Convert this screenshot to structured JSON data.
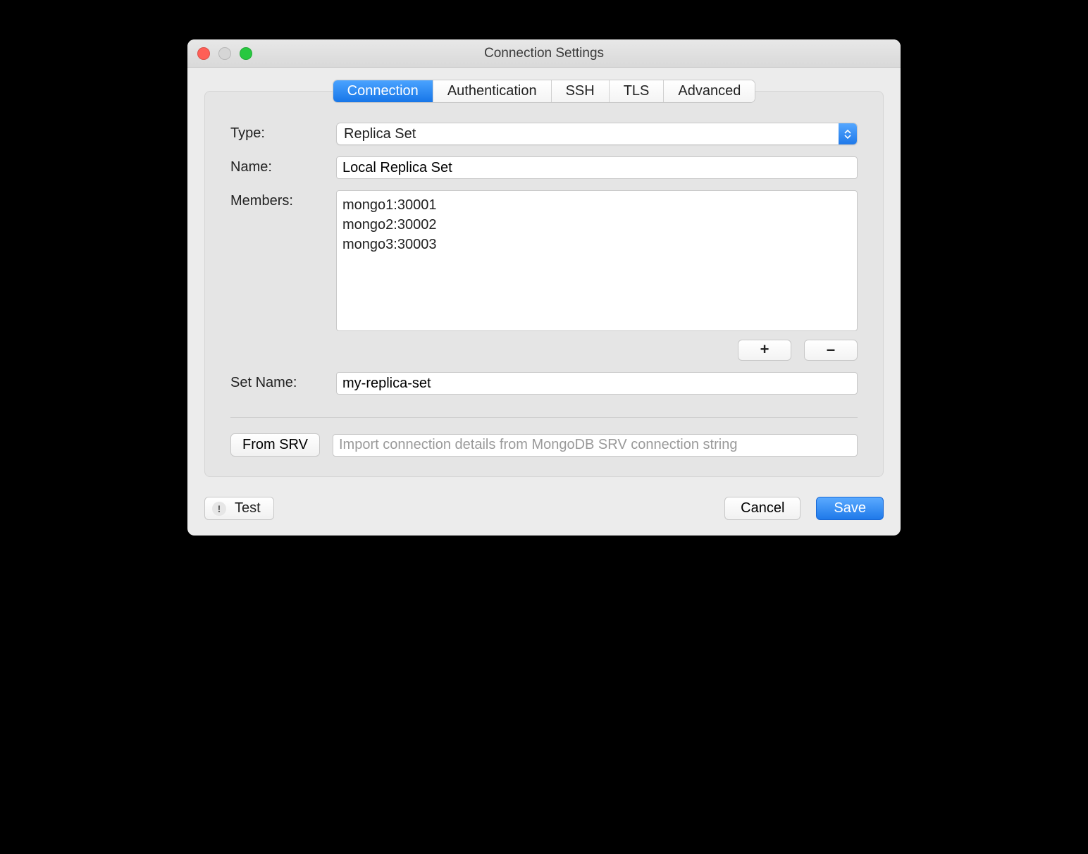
{
  "window": {
    "title": "Connection Settings"
  },
  "tabs": {
    "connection": "Connection",
    "authentication": "Authentication",
    "ssh": "SSH",
    "tls": "TLS",
    "advanced": "Advanced"
  },
  "form": {
    "type_label": "Type:",
    "type_value": "Replica Set",
    "name_label": "Name:",
    "name_value": "Local Replica Set",
    "members_label": "Members:",
    "members": [
      "mongo1:30001",
      "mongo2:30002",
      "mongo3:30003"
    ],
    "add_label": "+",
    "remove_label": "–",
    "setname_label": "Set Name:",
    "setname_value": "my-replica-set",
    "srv_button": "From SRV",
    "srv_placeholder": "Import connection details from MongoDB SRV connection string"
  },
  "footer": {
    "test": "Test",
    "cancel": "Cancel",
    "save": "Save"
  }
}
